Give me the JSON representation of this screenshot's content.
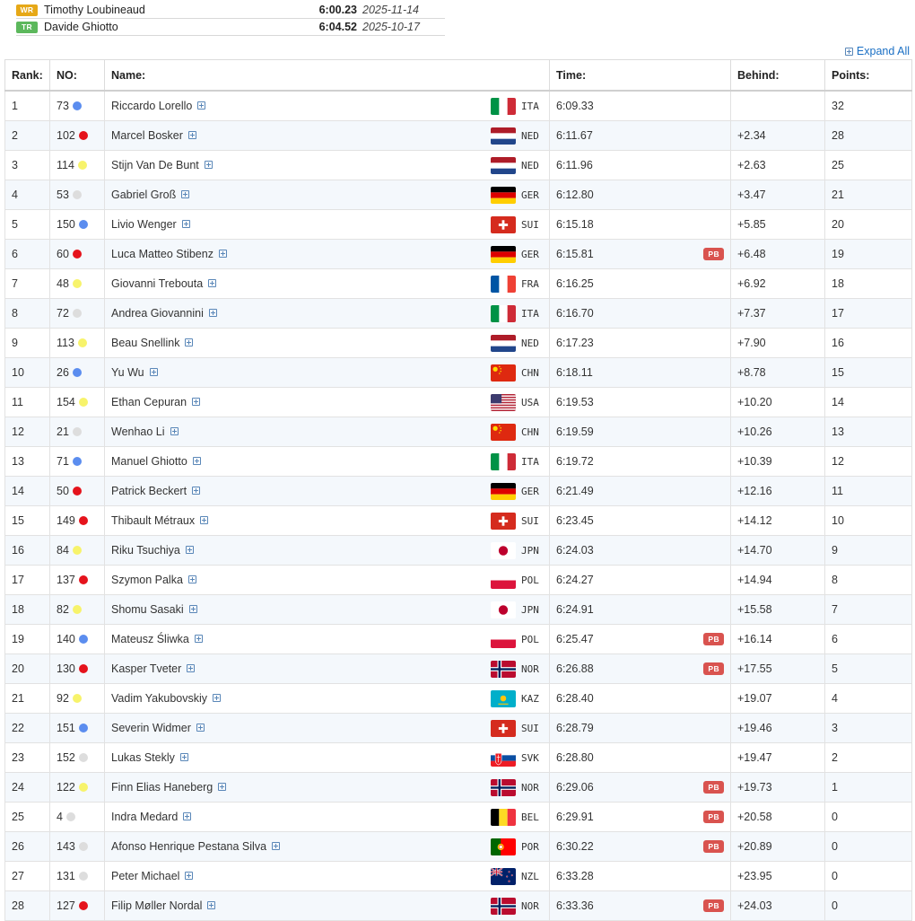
{
  "records": [
    {
      "badge": "WR",
      "badge_color": "#e6a817",
      "name": "Timothy Loubineaud",
      "time": "6:00.23",
      "date": "2025-11-14"
    },
    {
      "badge": "TR",
      "badge_color": "#5cb85c",
      "name": "Davide Ghiotto",
      "time": "6:04.52",
      "date": "2025-10-17"
    }
  ],
  "expand_all_label": "Expand All",
  "headers": {
    "rank": "Rank:",
    "no": "NO:",
    "name": "Name:",
    "time": "Time:",
    "behind": "Behind:",
    "points": "Points:"
  },
  "dot_colors": {
    "blue": "#5b8def",
    "red": "#e5131c",
    "yellow": "#f7f36b",
    "white": "#dddddd"
  },
  "pb_label": "PB",
  "rows": [
    {
      "rank": "1",
      "no": "73",
      "dot": "blue",
      "name": "Riccardo Lorello",
      "nat": "ITA",
      "time": "6:09.33",
      "pb": false,
      "behind": "",
      "points": "32"
    },
    {
      "rank": "2",
      "no": "102",
      "dot": "red",
      "name": "Marcel Bosker",
      "nat": "NED",
      "time": "6:11.67",
      "pb": false,
      "behind": "+2.34",
      "points": "28"
    },
    {
      "rank": "3",
      "no": "114",
      "dot": "yellow",
      "name": "Stijn Van De Bunt",
      "nat": "NED",
      "time": "6:11.96",
      "pb": false,
      "behind": "+2.63",
      "points": "25"
    },
    {
      "rank": "4",
      "no": "53",
      "dot": "white",
      "name": "Gabriel Groß",
      "nat": "GER",
      "time": "6:12.80",
      "pb": false,
      "behind": "+3.47",
      "points": "21"
    },
    {
      "rank": "5",
      "no": "150",
      "dot": "blue",
      "name": "Livio Wenger",
      "nat": "SUI",
      "time": "6:15.18",
      "pb": false,
      "behind": "+5.85",
      "points": "20"
    },
    {
      "rank": "6",
      "no": "60",
      "dot": "red",
      "name": "Luca Matteo Stibenz",
      "nat": "GER",
      "time": "6:15.81",
      "pb": true,
      "behind": "+6.48",
      "points": "19"
    },
    {
      "rank": "7",
      "no": "48",
      "dot": "yellow",
      "name": "Giovanni Trebouta",
      "nat": "FRA",
      "time": "6:16.25",
      "pb": false,
      "behind": "+6.92",
      "points": "18"
    },
    {
      "rank": "8",
      "no": "72",
      "dot": "white",
      "name": "Andrea Giovannini",
      "nat": "ITA",
      "time": "6:16.70",
      "pb": false,
      "behind": "+7.37",
      "points": "17"
    },
    {
      "rank": "9",
      "no": "113",
      "dot": "yellow",
      "name": "Beau Snellink",
      "nat": "NED",
      "time": "6:17.23",
      "pb": false,
      "behind": "+7.90",
      "points": "16"
    },
    {
      "rank": "10",
      "no": "26",
      "dot": "blue",
      "name": "Yu Wu",
      "nat": "CHN",
      "time": "6:18.11",
      "pb": false,
      "behind": "+8.78",
      "points": "15"
    },
    {
      "rank": "11",
      "no": "154",
      "dot": "yellow",
      "name": "Ethan Cepuran",
      "nat": "USA",
      "time": "6:19.53",
      "pb": false,
      "behind": "+10.20",
      "points": "14"
    },
    {
      "rank": "12",
      "no": "21",
      "dot": "white",
      "name": "Wenhao Li",
      "nat": "CHN",
      "time": "6:19.59",
      "pb": false,
      "behind": "+10.26",
      "points": "13"
    },
    {
      "rank": "13",
      "no": "71",
      "dot": "blue",
      "name": "Manuel Ghiotto",
      "nat": "ITA",
      "time": "6:19.72",
      "pb": false,
      "behind": "+10.39",
      "points": "12"
    },
    {
      "rank": "14",
      "no": "50",
      "dot": "red",
      "name": "Patrick Beckert",
      "nat": "GER",
      "time": "6:21.49",
      "pb": false,
      "behind": "+12.16",
      "points": "11"
    },
    {
      "rank": "15",
      "no": "149",
      "dot": "red",
      "name": "Thibault Métraux",
      "nat": "SUI",
      "time": "6:23.45",
      "pb": false,
      "behind": "+14.12",
      "points": "10"
    },
    {
      "rank": "16",
      "no": "84",
      "dot": "yellow",
      "name": "Riku Tsuchiya",
      "nat": "JPN",
      "time": "6:24.03",
      "pb": false,
      "behind": "+14.70",
      "points": "9"
    },
    {
      "rank": "17",
      "no": "137",
      "dot": "red",
      "name": "Szymon Palka",
      "nat": "POL",
      "time": "6:24.27",
      "pb": false,
      "behind": "+14.94",
      "points": "8"
    },
    {
      "rank": "18",
      "no": "82",
      "dot": "yellow",
      "name": "Shomu Sasaki",
      "nat": "JPN",
      "time": "6:24.91",
      "pb": false,
      "behind": "+15.58",
      "points": "7"
    },
    {
      "rank": "19",
      "no": "140",
      "dot": "blue",
      "name": "Mateusz Śliwka",
      "nat": "POL",
      "time": "6:25.47",
      "pb": true,
      "behind": "+16.14",
      "points": "6"
    },
    {
      "rank": "20",
      "no": "130",
      "dot": "red",
      "name": "Kasper Tveter",
      "nat": "NOR",
      "time": "6:26.88",
      "pb": true,
      "behind": "+17.55",
      "points": "5"
    },
    {
      "rank": "21",
      "no": "92",
      "dot": "yellow",
      "name": "Vadim Yakubovskiy",
      "nat": "KAZ",
      "time": "6:28.40",
      "pb": false,
      "behind": "+19.07",
      "points": "4"
    },
    {
      "rank": "22",
      "no": "151",
      "dot": "blue",
      "name": "Severin Widmer",
      "nat": "SUI",
      "time": "6:28.79",
      "pb": false,
      "behind": "+19.46",
      "points": "3"
    },
    {
      "rank": "23",
      "no": "152",
      "dot": "white",
      "name": "Lukas Stekly",
      "nat": "SVK",
      "time": "6:28.80",
      "pb": false,
      "behind": "+19.47",
      "points": "2"
    },
    {
      "rank": "24",
      "no": "122",
      "dot": "yellow",
      "name": "Finn Elias Haneberg",
      "nat": "NOR",
      "time": "6:29.06",
      "pb": true,
      "behind": "+19.73",
      "points": "1"
    },
    {
      "rank": "25",
      "no": "4",
      "dot": "white",
      "name": "Indra Medard",
      "nat": "BEL",
      "time": "6:29.91",
      "pb": true,
      "behind": "+20.58",
      "points": "0"
    },
    {
      "rank": "26",
      "no": "143",
      "dot": "white",
      "name": "Afonso Henrique Pestana Silva",
      "nat": "POR",
      "time": "6:30.22",
      "pb": true,
      "behind": "+20.89",
      "points": "0"
    },
    {
      "rank": "27",
      "no": "131",
      "dot": "white",
      "name": "Peter Michael",
      "nat": "NZL",
      "time": "6:33.28",
      "pb": false,
      "behind": "+23.95",
      "points": "0"
    },
    {
      "rank": "28",
      "no": "127",
      "dot": "red",
      "name": "Filip Møller Nordal",
      "nat": "NOR",
      "time": "6:33.36",
      "pb": true,
      "behind": "+24.03",
      "points": "0"
    }
  ]
}
